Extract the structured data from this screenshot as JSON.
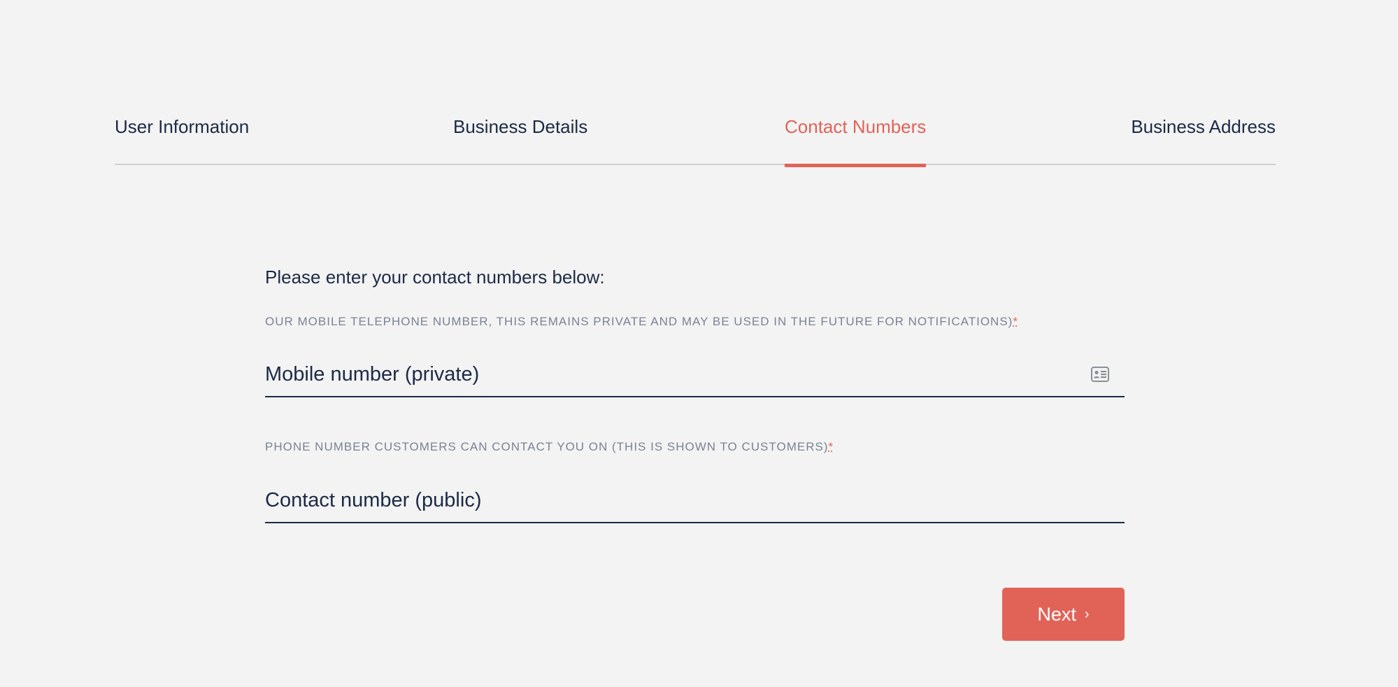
{
  "tabs": [
    {
      "label": "User Information",
      "active": false
    },
    {
      "label": "Business Details",
      "active": false
    },
    {
      "label": "Contact Numbers",
      "active": true
    },
    {
      "label": "Business Address",
      "active": false
    }
  ],
  "form": {
    "intro": "Please enter your contact numbers below:",
    "mobile": {
      "label": "OUR MOBILE TELEPHONE NUMBER, THIS REMAINS PRIVATE AND MAY BE USED IN THE FUTURE FOR NOTIFICATIONS)",
      "required_mark": "*",
      "placeholder": "Mobile number (private)",
      "value": "",
      "icon": "contact-card-icon"
    },
    "contact": {
      "label": "PHONE NUMBER CUSTOMERS CAN CONTACT YOU ON (THIS IS SHOWN TO CUSTOMERS)",
      "required_mark": "*",
      "placeholder": "Contact number (public)",
      "value": ""
    }
  },
  "next_button": {
    "label": "Next",
    "icon": "chevron-right-icon"
  },
  "colors": {
    "accent": "#e16358",
    "text": "#1c2a45",
    "muted": "#7a8293",
    "background": "#f3f3f3"
  }
}
